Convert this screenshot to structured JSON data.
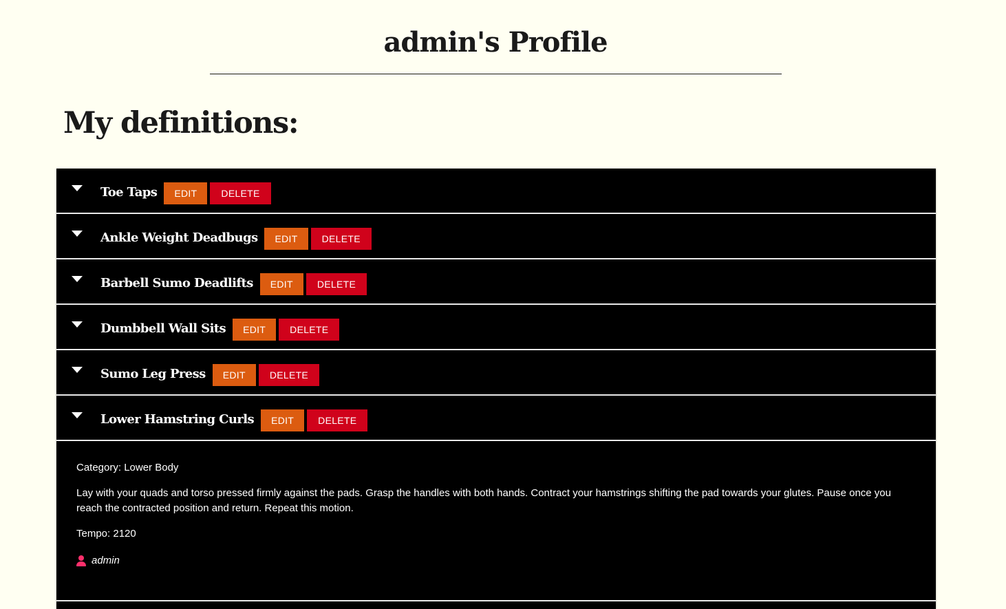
{
  "page": {
    "title": "admin's Profile",
    "section_heading": "My definitions:"
  },
  "colors": {
    "background": "#fffff2",
    "accordion_bg": "#000000",
    "edit_button": "#dc5c10",
    "delete_button": "#d0021b",
    "user_icon": "#ff2f6b"
  },
  "definitions": [
    {
      "name": "Toe Taps",
      "edit_label": "EDIT",
      "delete_label": "DELETE"
    },
    {
      "name": "Ankle Weight Deadbugs",
      "edit_label": "EDIT",
      "delete_label": "DELETE"
    },
    {
      "name": "Barbell Sumo Deadlifts",
      "edit_label": "EDIT",
      "delete_label": "DELETE"
    },
    {
      "name": "Dumbbell Wall Sits",
      "edit_label": "EDIT",
      "delete_label": "DELETE"
    },
    {
      "name": "Sumo Leg Press",
      "edit_label": "EDIT",
      "delete_label": "DELETE"
    },
    {
      "name": "Lower Hamstring Curls",
      "edit_label": "EDIT",
      "delete_label": "DELETE"
    }
  ],
  "expanded": {
    "category": "Category: Lower Body",
    "description": "Lay with your quads and torso pressed firmly against the pads. Grasp the handles with both hands. Contract your hamstrings shifting the pad towards your glutes. Pause once you reach the contracted position and return. Repeat this motion.",
    "tempo": "Tempo: 2120",
    "author": "admin",
    "author_icon": "user-icon"
  }
}
